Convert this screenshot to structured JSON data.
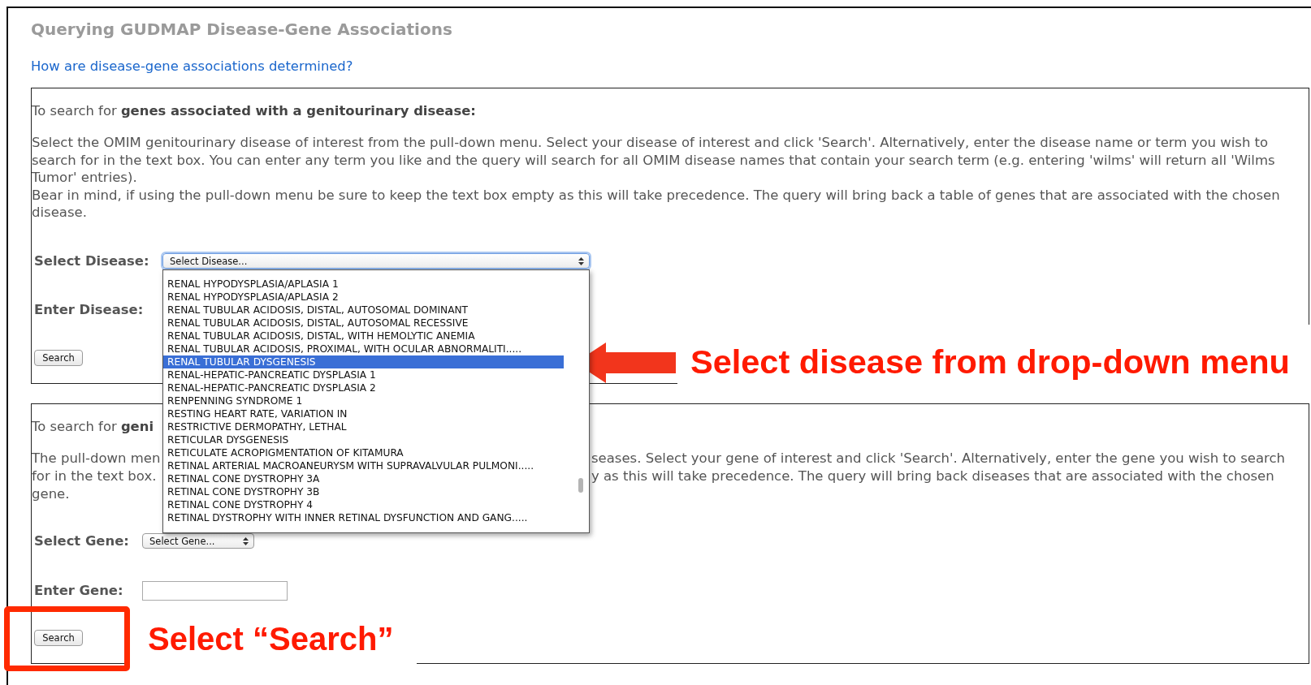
{
  "page": {
    "title": "Querying GUDMAP Disease-Gene Associations",
    "help_link": "How are disease-gene associations determined?"
  },
  "disease_panel": {
    "heading": "To search for **genes associated with a genitourinary disease:**",
    "description": [
      "Select the OMIM genitourinary disease of interest from the pull-down menu. Select your disease of interest and click 'Search'. Alternatively, enter the disease name or term you wish to search for in the text box. You can enter any term you like and the query will search for all OMIM disease names that contain your search term (e.g. entering 'wilms' will return all 'Wilms Tumor' entries).",
      "Bear in mind, if using the pull-down menu be sure to keep the text box empty as this will take precedence. The query will bring back a table of genes that are associated with the chosen disease."
    ],
    "select_label": "Select Disease:",
    "select_value": "Select Disease...",
    "enter_label": "Enter Disease:",
    "search_button": "Search",
    "dropdown": {
      "items": [
        {
          "label": "RENAL HYPODYSPLASIA/APLASIA 1",
          "selected": false
        },
        {
          "label": "RENAL HYPODYSPLASIA/APLASIA 2",
          "selected": false
        },
        {
          "label": "RENAL TUBULAR ACIDOSIS, DISTAL, AUTOSOMAL DOMINANT",
          "selected": false
        },
        {
          "label": "RENAL TUBULAR ACIDOSIS, DISTAL, AUTOSOMAL RECESSIVE",
          "selected": false
        },
        {
          "label": "RENAL TUBULAR ACIDOSIS, DISTAL, WITH HEMOLYTIC ANEMIA",
          "selected": false
        },
        {
          "label": "RENAL TUBULAR ACIDOSIS, PROXIMAL, WITH OCULAR ABNORMALITI.....",
          "selected": false
        },
        {
          "label": "RENAL TUBULAR DYSGENESIS",
          "selected": true
        },
        {
          "label": "RENAL-HEPATIC-PANCREATIC DYSPLASIA 1",
          "selected": false
        },
        {
          "label": "RENAL-HEPATIC-PANCREATIC DYSPLASIA 2",
          "selected": false
        },
        {
          "label": "RENPENNING SYNDROME 1",
          "selected": false
        },
        {
          "label": "RESTING HEART RATE, VARIATION IN",
          "selected": false
        },
        {
          "label": "RESTRICTIVE DERMOPATHY, LETHAL",
          "selected": false
        },
        {
          "label": "RETICULAR DYSGENESIS",
          "selected": false
        },
        {
          "label": "RETICULATE ACROPIGMENTATION OF KITAMURA",
          "selected": false
        },
        {
          "label": "RETINAL ARTERIAL MACROANEURYSM WITH SUPRAVALVULAR PULMONI.....",
          "selected": false
        },
        {
          "label": "RETINAL CONE DYSTROPHY 3A",
          "selected": false
        },
        {
          "label": "RETINAL CONE DYSTROPHY 3B",
          "selected": false
        },
        {
          "label": "RETINAL CONE DYSTROPHY 4",
          "selected": false
        },
        {
          "label": "RETINAL DYSTROPHY WITH INNER RETINAL DYSFUNCTION AND GANG.....",
          "selected": false
        }
      ]
    }
  },
  "gene_panel": {
    "heading": "To search for **geni**",
    "description_lines": [
      {
        "left": "The pull-down men",
        "right": "seases. Select your gene of interest and click 'Search'. Alternatively, enter the gene you wish to search"
      },
      {
        "left": "for in the text box.",
        "right": "y as this will take precedence. The query will bring back diseases that are associated with the chosen"
      },
      {
        "left": "gene."
      }
    ],
    "select_label": "Select Gene:",
    "select_value": "Select Gene...",
    "enter_label": "Enter Gene:",
    "search_button": "Search"
  },
  "annotations": [
    {
      "kind": "arrow",
      "text": "Select disease from drop-down menu"
    },
    {
      "kind": "box",
      "text": "Select “Search”"
    }
  ]
}
